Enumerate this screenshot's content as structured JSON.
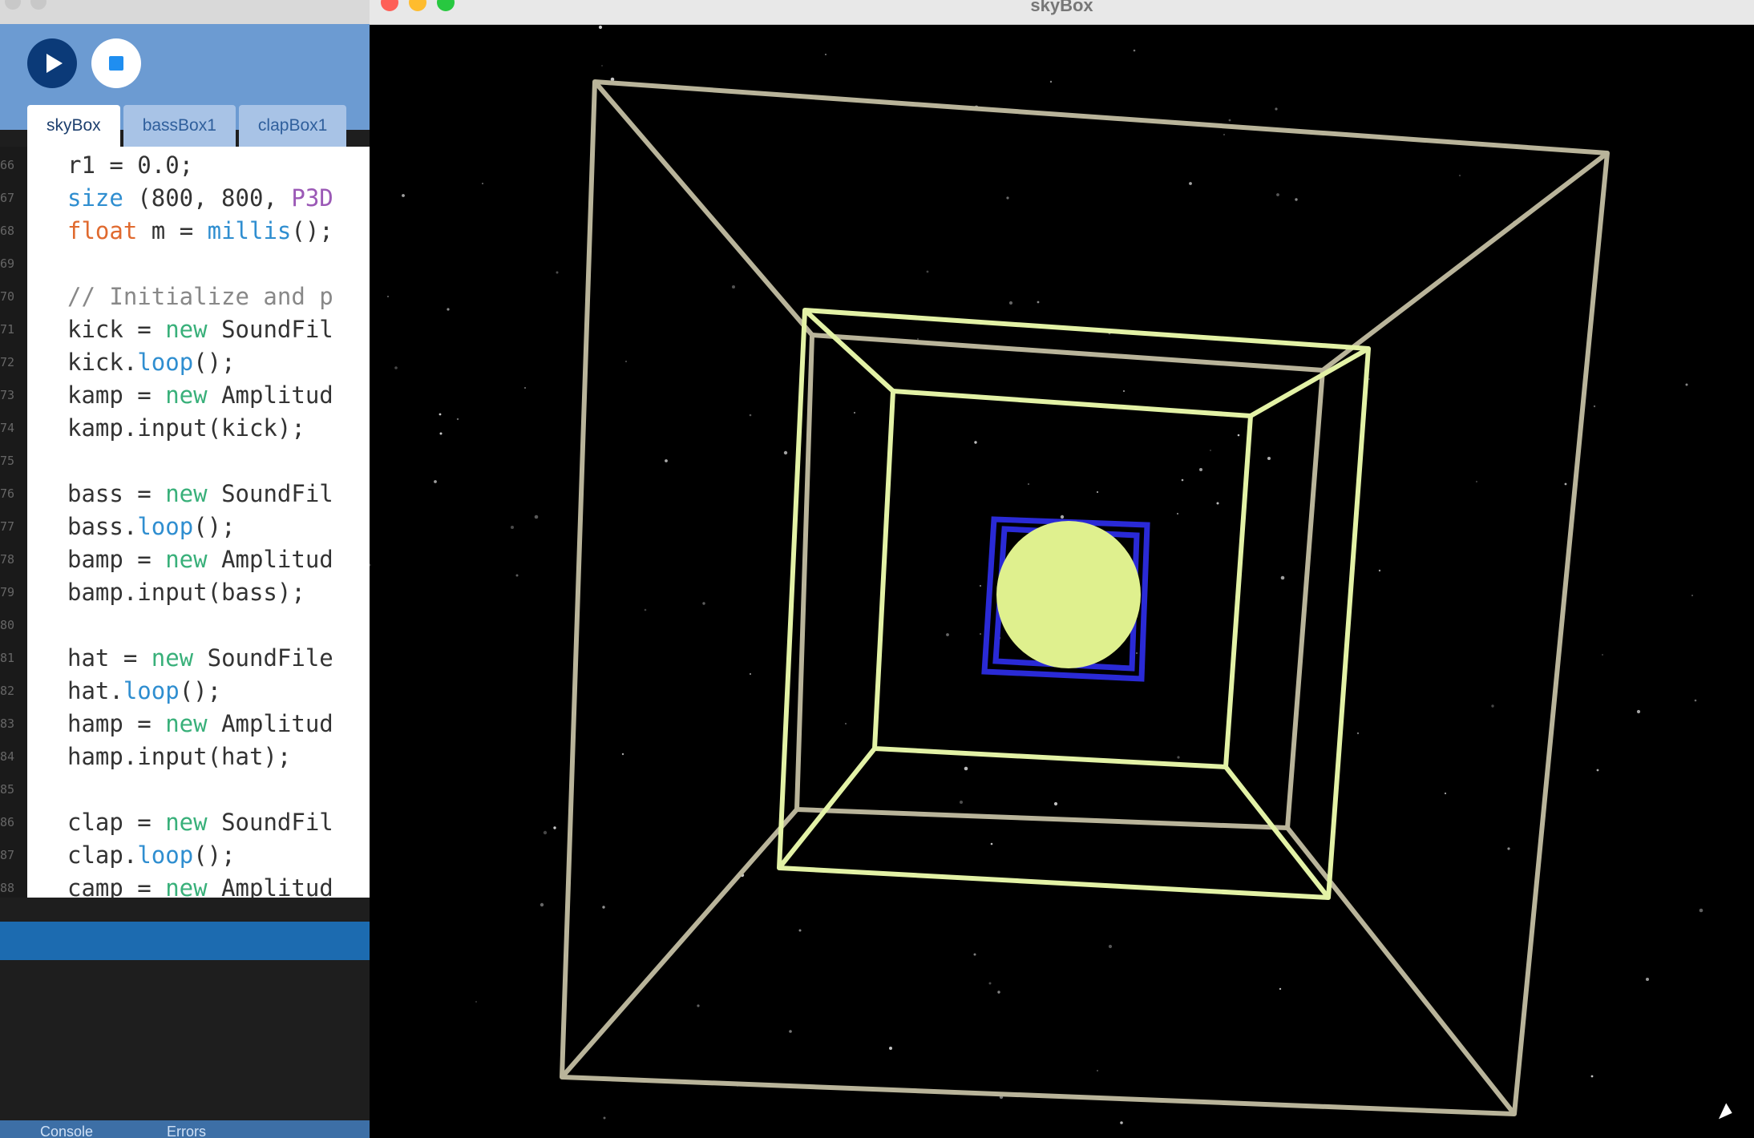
{
  "ide": {
    "tabs": [
      "skyBox",
      "bassBox1",
      "clapBox1"
    ],
    "line_numbers": [
      "66",
      "67",
      "68",
      "69",
      "70",
      "71",
      "72",
      "73",
      "74",
      "75",
      "76",
      "77",
      "78",
      "79",
      "80",
      "81",
      "82",
      "83",
      "84",
      "85",
      "86",
      "87",
      "88"
    ],
    "code": [
      [
        {
          "t": "r1 = 0.0;"
        }
      ],
      [
        {
          "t": "size",
          "c": "fn"
        },
        {
          "t": " (800, 800, "
        },
        {
          "t": "P3D",
          "c": "p3d"
        }
      ],
      [
        {
          "t": "float",
          "c": "type"
        },
        {
          "t": " m = "
        },
        {
          "t": "millis",
          "c": "fn"
        },
        {
          "t": "();"
        }
      ],
      [
        {
          "t": ""
        }
      ],
      [
        {
          "t": "// Initialize and p",
          "c": "cmt"
        }
      ],
      [
        {
          "t": "kick = "
        },
        {
          "t": "new",
          "c": "new"
        },
        {
          "t": " SoundFil"
        }
      ],
      [
        {
          "t": "kick."
        },
        {
          "t": "loop",
          "c": "fn"
        },
        {
          "t": "();"
        }
      ],
      [
        {
          "t": "kamp = "
        },
        {
          "t": "new",
          "c": "new"
        },
        {
          "t": " Amplitud"
        }
      ],
      [
        {
          "t": "kamp.input(kick);"
        }
      ],
      [
        {
          "t": ""
        }
      ],
      [
        {
          "t": "bass = "
        },
        {
          "t": "new",
          "c": "new"
        },
        {
          "t": " SoundFil"
        }
      ],
      [
        {
          "t": "bass."
        },
        {
          "t": "loop",
          "c": "fn"
        },
        {
          "t": "();"
        }
      ],
      [
        {
          "t": "bamp = "
        },
        {
          "t": "new",
          "c": "new"
        },
        {
          "t": " Amplitud"
        }
      ],
      [
        {
          "t": "bamp.input(bass);"
        }
      ],
      [
        {
          "t": ""
        }
      ],
      [
        {
          "t": "hat = "
        },
        {
          "t": "new",
          "c": "new"
        },
        {
          "t": " SoundFile"
        }
      ],
      [
        {
          "t": "hat."
        },
        {
          "t": "loop",
          "c": "fn"
        },
        {
          "t": "();"
        }
      ],
      [
        {
          "t": "hamp = "
        },
        {
          "t": "new",
          "c": "new"
        },
        {
          "t": " Amplitud"
        }
      ],
      [
        {
          "t": "hamp.input(hat);"
        }
      ],
      [
        {
          "t": ""
        }
      ],
      [
        {
          "t": "clap = "
        },
        {
          "t": "new",
          "c": "new"
        },
        {
          "t": " SoundFil"
        }
      ],
      [
        {
          "t": "clap."
        },
        {
          "t": "loop",
          "c": "fn"
        },
        {
          "t": "();"
        }
      ],
      [
        {
          "t": "camp = "
        },
        {
          "t": "new",
          "c": "new"
        },
        {
          "t": " Amplitud"
        }
      ]
    ],
    "console_tabs": [
      "Console",
      "Errors"
    ],
    "icons": {
      "run": "play-icon",
      "stop": "stop-icon"
    }
  },
  "sketch": {
    "title": "skyBox",
    "colors": {
      "outer_frame": "#b9b49a",
      "inner_frame": "#e3f2a6",
      "core_box": "#2a2ad6",
      "sphere": "#dff08e",
      "stars": "#ffffff"
    }
  }
}
